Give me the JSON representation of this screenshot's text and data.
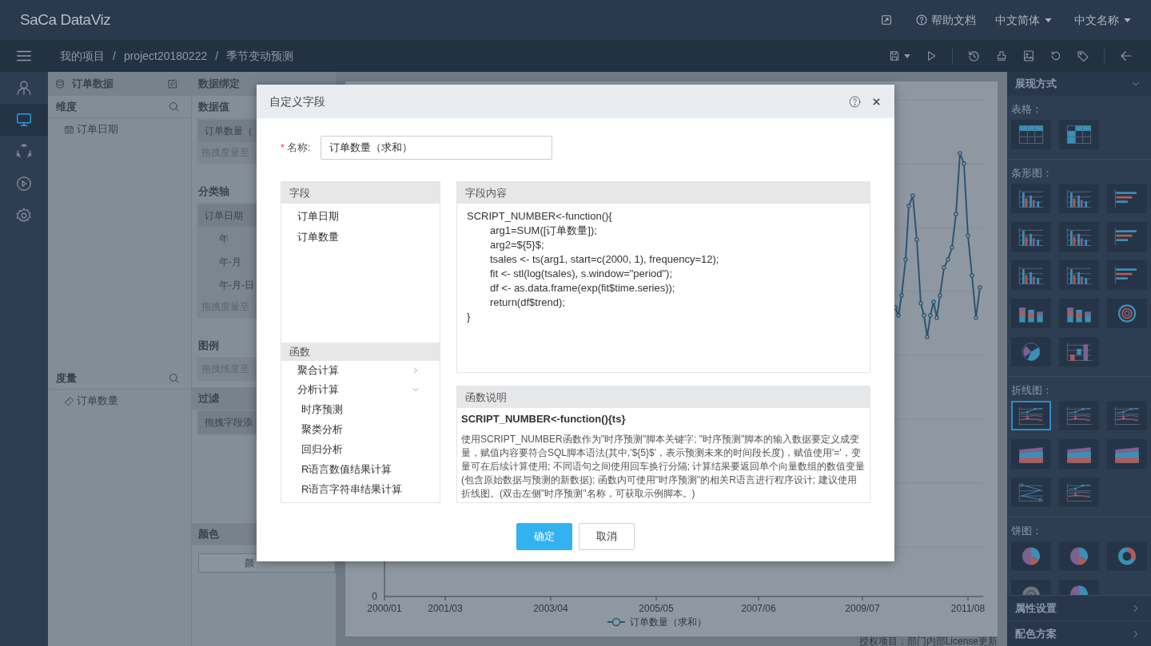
{
  "app": {
    "logo": "SaCa DataViz",
    "help": "帮助文档",
    "language": "中文简体",
    "name_mode": "中文名称"
  },
  "breadcrumb": {
    "items": [
      "我的项目",
      "project20180222",
      "季节变动预测"
    ],
    "separator": "/"
  },
  "rail": [
    {
      "kind": "user",
      "selected": false
    },
    {
      "kind": "monitor",
      "selected": true
    },
    {
      "kind": "cycle",
      "selected": false
    },
    {
      "kind": "play",
      "selected": false
    },
    {
      "kind": "settings",
      "selected": false
    }
  ],
  "data_panel": {
    "title": "订单数据",
    "dimensions": {
      "label": "维度",
      "items": [
        {
          "kind": "date",
          "label": "订单日期"
        }
      ]
    },
    "measures": {
      "label": "度量",
      "items": [
        {
          "kind": "measure",
          "label": "订单数量"
        }
      ]
    }
  },
  "binding": {
    "title": "数据绑定",
    "sections": [
      {
        "label": "数据值",
        "band": false,
        "items": [
          {
            "kind": "field",
            "label": "订单数量（"
          },
          {
            "kind": "hint",
            "label": "拖拽度量至"
          }
        ]
      },
      {
        "label": "分类轴",
        "band": false,
        "items": [
          {
            "kind": "field",
            "label": "订单日期"
          },
          {
            "kind": "level",
            "label": "年"
          },
          {
            "kind": "level",
            "label": "年-月"
          },
          {
            "kind": "level",
            "label": "年-月-日"
          },
          {
            "kind": "hint",
            "label": "拖拽度量至"
          }
        ]
      },
      {
        "label": "图例",
        "band": false,
        "items": [
          {
            "kind": "hint",
            "label": "拖拽维度至"
          }
        ]
      },
      {
        "label": "过滤",
        "band": true,
        "items": [
          {
            "kind": "field",
            "label": "拖拽字段添"
          }
        ]
      }
    ],
    "color": {
      "label": "颜色",
      "button": "颜"
    }
  },
  "chart": {
    "y_label": "0",
    "x_labels": [
      "2000/01",
      "2001/03",
      "2003/04",
      "2005/05",
      "2007/06",
      "2009/07",
      "2011/08"
    ],
    "legend": "订单数量（求和）"
  },
  "footer": "授权项目：部门内部License更新",
  "dialog": {
    "title": "自定义字段",
    "required_mark": "*",
    "name_label": "名称:",
    "name_value": "订单数量（求和）",
    "fields": {
      "title": "字段",
      "items": [
        "订单日期",
        "订单数量"
      ]
    },
    "functions": {
      "title": "函数",
      "items": [
        {
          "label": "聚合计算",
          "expanded": false
        },
        {
          "label": "分析计算",
          "expanded": true,
          "children": [
            "时序预测",
            "聚类分析",
            "回归分析",
            "R语言数值结果计算",
            "R语言字符串结果计算"
          ]
        }
      ]
    },
    "content": {
      "title": "字段内容",
      "code": "SCRIPT_NUMBER<-function(){\n\targ1=SUM([订单数量]);\n\targ2=${5}$;\n\ttsales <- ts(arg1, start=c(2000, 1), frequency=12);\n\tfit <- stl(log(tsales), s.window=\"period\");\n\tdf <- as.data.frame(exp(fit$time.series));\n\treturn(df$trend);\n}"
    },
    "description": {
      "title": "函数说明",
      "signature": "SCRIPT_NUMBER<-function(){ts}",
      "text": "使用SCRIPT_NUMBER函数作为\"时序预测\"脚本关键字; \"时序预测\"脚本的输入数据要定义成变量，赋值内容要符合SQL脚本语法(其中,'${5}$'，表示预测未来的时间段长度)，赋值使用'='，变量可在后续计算使用; 不同语句之间使用回车换行分隔; 计算结果要返回单个向量数组的数值变量(包含原始数据与预测的新数据); 函数内可使用\"时序预测\"的相关R语言进行程序设计; 建议使用折线图。(双击左侧\"时序预测\"名称，可获取示例脚本。)"
    },
    "buttons": [
      {
        "label": "确定",
        "kind": "primary"
      },
      {
        "label": "取消",
        "kind": "secondary"
      }
    ]
  },
  "display_panel": {
    "title": "展现方式",
    "expanded": true,
    "groups": [
      {
        "label": "表格：",
        "items": [
          {
            "kind": "table",
            "selected": false
          },
          {
            "kind": "pivot",
            "selected": false
          }
        ]
      },
      {
        "label": "条形图：",
        "items": [
          {
            "kind": "bar",
            "selected": false
          },
          {
            "kind": "bar",
            "selected": false
          },
          {
            "kind": "hbar",
            "selected": false
          },
          {
            "kind": "bar",
            "selected": false
          },
          {
            "kind": "bar",
            "selected": false
          },
          {
            "kind": "hbar",
            "selected": false
          },
          {
            "kind": "bar",
            "selected": false
          },
          {
            "kind": "bar",
            "selected": false
          },
          {
            "kind": "hbar",
            "selected": false
          },
          {
            "kind": "column3d",
            "selected": false
          },
          {
            "kind": "column3d",
            "selected": false
          },
          {
            "kind": "radial",
            "selected": false
          },
          {
            "kind": "polar",
            "selected": false
          },
          {
            "kind": "waterfall",
            "selected": false
          }
        ]
      },
      {
        "label": "折线图：",
        "items": [
          {
            "kind": "line",
            "selected": true
          },
          {
            "kind": "line",
            "selected": false
          },
          {
            "kind": "line",
            "selected": false
          },
          {
            "kind": "area",
            "selected": false
          },
          {
            "kind": "area",
            "selected": false
          },
          {
            "kind": "area",
            "selected": false
          },
          {
            "kind": "zigzag",
            "selected": false
          },
          {
            "kind": "line",
            "selected": false
          }
        ]
      },
      {
        "label": "饼图：",
        "items": [
          {
            "kind": "pie",
            "selected": false
          },
          {
            "kind": "pie",
            "selected": false
          },
          {
            "kind": "donut",
            "selected": false
          },
          {
            "kind": "gauge",
            "selected": false
          },
          {
            "kind": "pie",
            "selected": false
          }
        ]
      }
    ]
  },
  "collapsed_sections": [
    {
      "label": "属性设置",
      "expanded": false
    },
    {
      "label": "配色方案",
      "expanded": false
    }
  ]
}
